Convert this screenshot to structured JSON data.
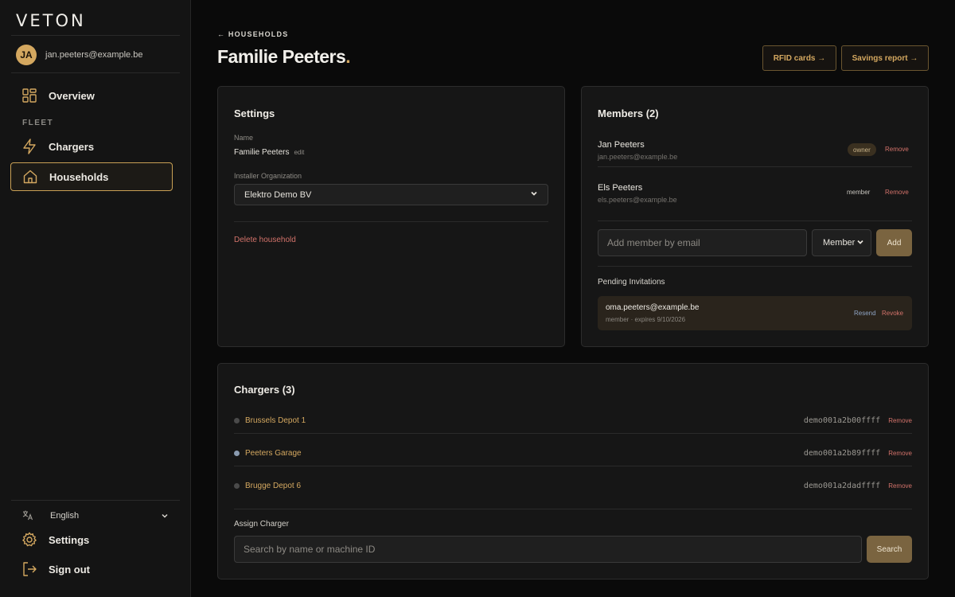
{
  "app": {
    "logo": "VETON"
  },
  "user": {
    "initials": "JA",
    "email": "jan.peeters@example.be"
  },
  "sidebar": {
    "overview": "Overview",
    "section_label": "FLEET",
    "chargers": "Chargers",
    "households": "Households",
    "language": "English",
    "settings": "Settings",
    "sign_out": "Sign out"
  },
  "header": {
    "back_link": "← HOUSEHOLDS",
    "title": "Familie Peeters",
    "title_dot": ".",
    "rfid_button": "RFID cards →",
    "savings_button": "Savings report →"
  },
  "settings_card": {
    "title": "Settings",
    "name_label": "Name",
    "name_value": "Familie Peeters",
    "edit_link": "edit",
    "org_label": "Installer Organization",
    "org_value": "Elektro Demo BV",
    "delete_link": "Delete household"
  },
  "members_card": {
    "title": "Members (2)",
    "members": [
      {
        "name": "Jan Peeters",
        "email": "jan.peeters@example.be",
        "role": "owner",
        "remove": "Remove"
      },
      {
        "name": "Els Peeters",
        "email": "els.peeters@example.be",
        "role": "member",
        "remove": "Remove"
      }
    ],
    "add_placeholder": "Add member by email",
    "role_select": "Member",
    "add_button": "Add",
    "pending_label": "Pending Invitations",
    "invite": {
      "email": "oma.peeters@example.be",
      "meta": "member · expires 9/10/2026",
      "resend": "Resend",
      "revoke": "Revoke"
    }
  },
  "chargers_card": {
    "title": "Chargers (3)",
    "chargers": [
      {
        "name": "Brussels Depot 1",
        "id": "demo001a2b00ffff",
        "remove": "Remove",
        "status_color": "#4a4a4a"
      },
      {
        "name": "Peeters Garage",
        "id": "demo001a2b89ffff",
        "remove": "Remove",
        "status_color": "#8a9bb0"
      },
      {
        "name": "Brugge Depot 6",
        "id": "demo001a2dadffff",
        "remove": "Remove",
        "status_color": "#4a4a4a"
      }
    ],
    "assign_label": "Assign Charger",
    "search_placeholder": "Search by name or machine ID",
    "search_button": "Search"
  },
  "colors": {
    "accent": "#d4a860",
    "danger": "#d2726a",
    "background": "#0a0a0a"
  }
}
